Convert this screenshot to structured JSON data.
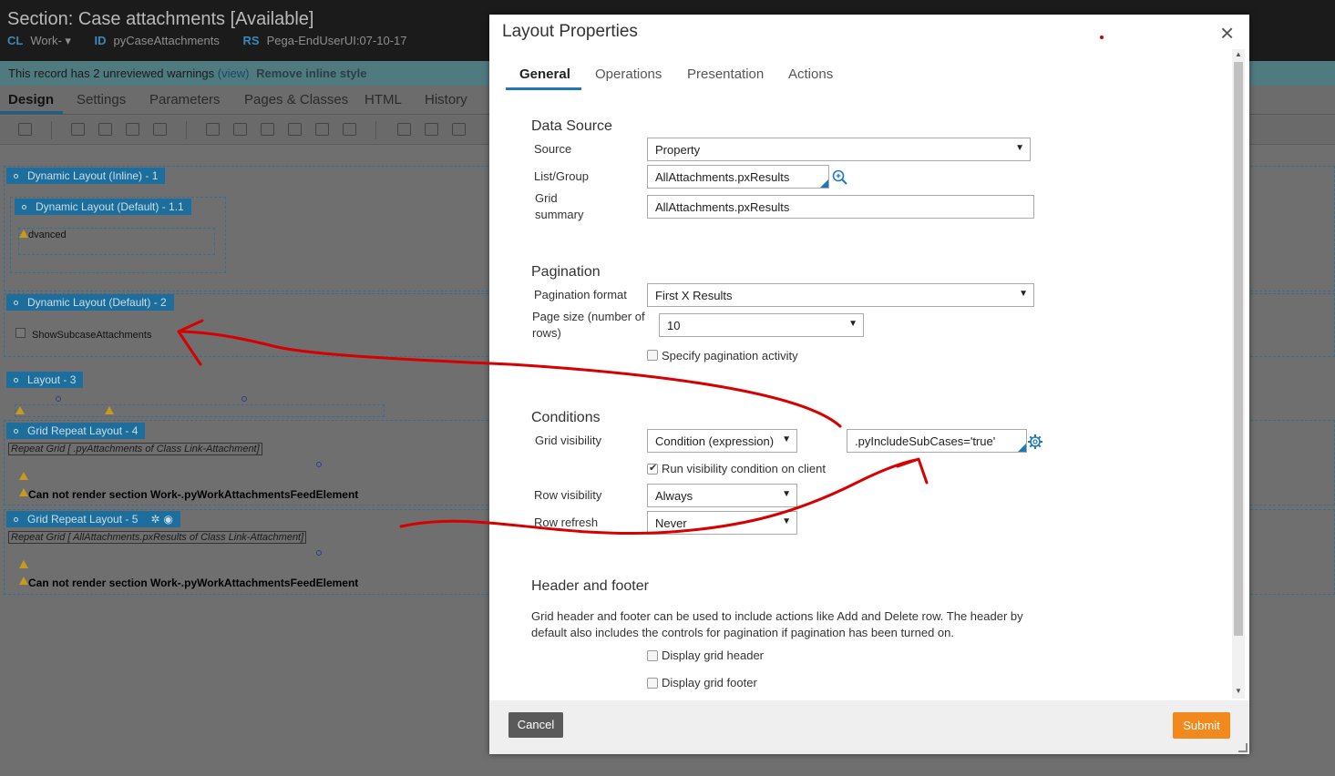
{
  "app": {
    "title": "Section: Case attachments [Available]",
    "meta": [
      {
        "key": "CL",
        "value": "Work- ▾"
      },
      {
        "key": "ID",
        "value": "pyCaseAttachments"
      },
      {
        "key": "RS",
        "value": "Pega-EndUserUI:07-10-17"
      }
    ],
    "warning": {
      "text": "This record has 2 unreviewed warnings",
      "view": "(view)",
      "remove": "Remove inline style"
    },
    "tabs": [
      "Design",
      "Settings",
      "Parameters",
      "Pages & Classes",
      "HTML",
      "History"
    ]
  },
  "canvas": {
    "layouts": [
      {
        "label": "Dynamic Layout (Inline) -   1"
      },
      {
        "label": "Dynamic Layout (Default) -   1.1"
      },
      {
        "label": "Dynamic Layout (Default) -   2"
      },
      {
        "label": "Layout -   3"
      },
      {
        "label": "Grid Repeat Layout -   4"
      },
      {
        "label": "Grid Repeat Layout -   5"
      }
    ],
    "advanced_text": "dvanced",
    "checkbox_label": "ShowSubcaseAttachments",
    "repeat_grid_4": "Repeat Grid [ .pyAttachments of Class Link-Attachment]",
    "repeat_grid_5": "Repeat Grid [ AllAttachments.pxResults of Class Link-Attachment]",
    "render_error": "Can not render section Work-.pyWorkAttachmentsFeedElement"
  },
  "modal": {
    "title": "Layout Properties",
    "tabs": [
      "General",
      "Operations",
      "Presentation",
      "Actions"
    ],
    "data_source": {
      "heading": "Data Source",
      "source_label": "Source",
      "source_value": "Property",
      "list_label": "List/Group",
      "list_value": "AllAttachments.pxResults",
      "summary_label_1": "Grid",
      "summary_label_2": "summary",
      "summary_value": "AllAttachments.pxResults"
    },
    "pagination": {
      "heading": "Pagination",
      "format_label": "Pagination format",
      "format_value": "First X Results",
      "size_label_1": "Page size (number of",
      "size_label_2": "rows)",
      "size_value": "10",
      "activity_label": "Specify pagination activity"
    },
    "conditions": {
      "heading": "Conditions",
      "grid_vis_label": "Grid visibility",
      "grid_vis_value": "Condition (expression)",
      "expression_value": ".pyIncludeSubCases='true'",
      "client_label": "Run visibility condition on client",
      "row_vis_label": "Row visibility",
      "row_vis_value": "Always",
      "row_refresh_label": "Row refresh",
      "row_refresh_value": "Never"
    },
    "header_footer": {
      "heading": "Header and footer",
      "description": "Grid header and footer can be used to include actions like Add and Delete row. The header by default also includes the controls for pagination if pagination has been turned on.",
      "display_header": "Display grid header",
      "display_footer": "Display grid footer"
    },
    "buttons": {
      "cancel": "Cancel",
      "submit": "Submit"
    },
    "close_icon": "×"
  },
  "colors": {
    "accent": "#1f78b4",
    "submit": "#f2891c",
    "annotation": "#d60000"
  }
}
